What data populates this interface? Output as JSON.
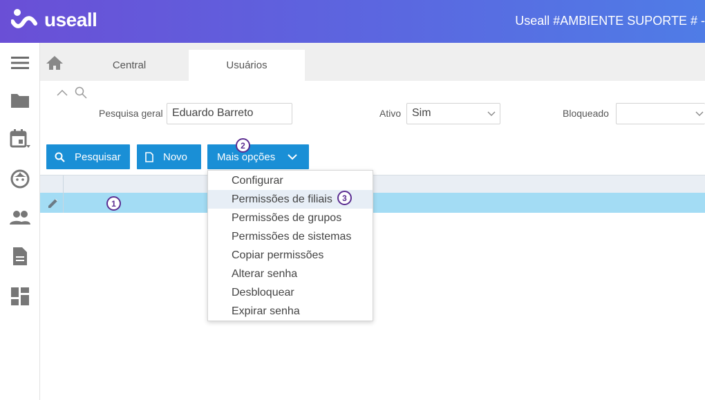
{
  "app": {
    "brand": "useall",
    "environment_title": "Useall #AMBIENTE SUPORTE # -"
  },
  "sidebar": {
    "items": [
      {
        "icon": "menu-icon"
      },
      {
        "icon": "folder-icon"
      },
      {
        "icon": "calendar-icon"
      },
      {
        "icon": "face-icon"
      },
      {
        "icon": "people-icon"
      },
      {
        "icon": "document-icon"
      },
      {
        "icon": "dashboard-icon"
      }
    ]
  },
  "tabs": [
    {
      "label": "Central",
      "active": false
    },
    {
      "label": "Usuários",
      "active": true
    }
  ],
  "filters": {
    "general_search": {
      "label": "Pesquisa geral",
      "value": "Eduardo Barreto"
    },
    "active": {
      "label": "Ativo",
      "value": "Sim"
    },
    "blocked": {
      "label": "Bloqueado",
      "value": ""
    }
  },
  "toolbar": {
    "search_label": "Pesquisar",
    "new_label": "Novo",
    "more_label": "Mais opções"
  },
  "dropdown": {
    "items": [
      "Configurar",
      "Permissões de filiais",
      "Permissões de grupos",
      "Permissões de sistemas",
      "Copiar permissões",
      "Alterar senha",
      "Desbloquear",
      "Expirar senha"
    ],
    "highlighted_index": 1
  },
  "annotations": {
    "step1": "1",
    "step2": "2",
    "step3": "3"
  },
  "colors": {
    "header_gradient_start": "#6a4fd6",
    "header_gradient_end": "#4f7ce6",
    "button_blue": "#1a8fd6",
    "selected_row": "#a3dcf4",
    "badge_purple": "#5b2d91"
  }
}
